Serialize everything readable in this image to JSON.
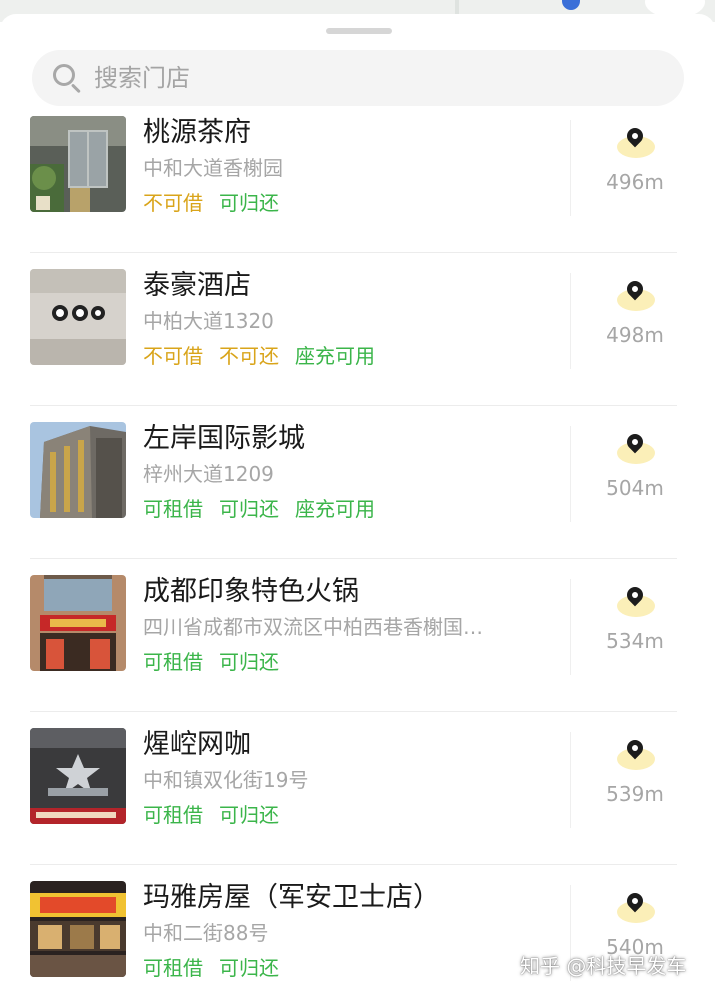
{
  "search": {
    "placeholder": "搜索门店"
  },
  "stores": [
    {
      "name": "桃源茶府",
      "address": "中和大道香榭园",
      "tags": [
        {
          "text": "不可借",
          "status": "warn"
        },
        {
          "text": "可归还",
          "status": "ok"
        }
      ],
      "distance": "496m"
    },
    {
      "name": "泰豪酒店",
      "address": "中柏大道1320",
      "tags": [
        {
          "text": "不可借",
          "status": "warn"
        },
        {
          "text": "不可还",
          "status": "warn"
        },
        {
          "text": "座充可用",
          "status": "ok"
        }
      ],
      "distance": "498m"
    },
    {
      "name": "左岸国际影城",
      "address": "梓州大道1209",
      "tags": [
        {
          "text": "可租借",
          "status": "ok"
        },
        {
          "text": "可归还",
          "status": "ok"
        },
        {
          "text": "座充可用",
          "status": "ok"
        }
      ],
      "distance": "504m"
    },
    {
      "name": "成都印象特色火锅",
      "address": "四川省成都市双流区中柏西巷香榭国…",
      "tags": [
        {
          "text": "可租借",
          "status": "ok"
        },
        {
          "text": "可归还",
          "status": "ok"
        }
      ],
      "distance": "534m"
    },
    {
      "name": "煋崆网咖",
      "address": "中和镇双化街19号",
      "tags": [
        {
          "text": "可租借",
          "status": "ok"
        },
        {
          "text": "可归还",
          "status": "ok"
        }
      ],
      "distance": "539m"
    },
    {
      "name": "玛雅房屋（军安卫士店）",
      "address": "中和二街88号",
      "tags": [
        {
          "text": "可租借",
          "status": "ok"
        },
        {
          "text": "可归还",
          "status": "ok"
        }
      ],
      "distance": "540m"
    }
  ],
  "colors": {
    "available": "#3bb54a",
    "unavailable": "#d9a41a",
    "pin": "#1c1c1c",
    "pin_glow": "#fbefb8"
  },
  "watermark": "知乎 @科技早发车"
}
